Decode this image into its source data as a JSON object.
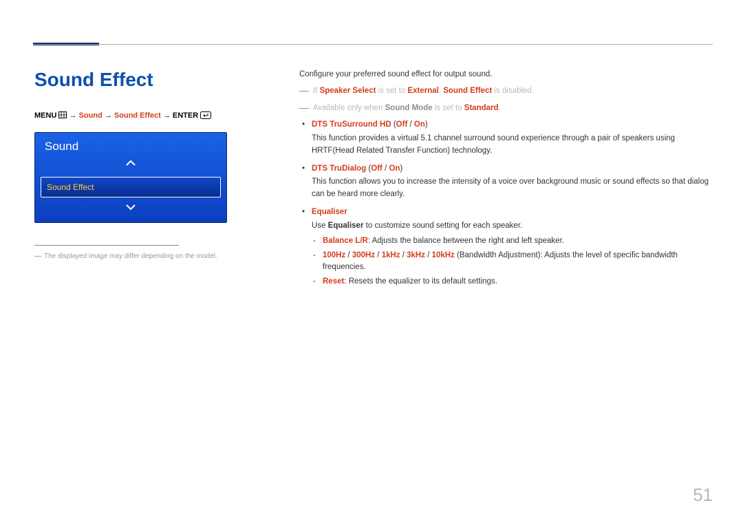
{
  "page_number": "51",
  "title": "Sound Effect",
  "path": {
    "menu_label": "MENU",
    "arrow": "→",
    "seg1": "Sound",
    "seg2": "Sound Effect",
    "enter_label": "ENTER"
  },
  "tvbox": {
    "header": "Sound",
    "item": "Sound Effect"
  },
  "left_note": "The displayed image may differ depending on the model.",
  "right": {
    "intro": "Configure your preferred sound effect for output sound.",
    "note1_pre": "If ",
    "note1_speaker_select": "Speaker Select",
    "note1_mid": " is set to ",
    "note1_external": "External",
    "note1_comma": ", ",
    "note1_sound_effect": "Sound Effect",
    "note1_post": " is disabled.",
    "note2_pre": "Available only when ",
    "note2_sound_mode": "Sound Mode",
    "note2_mid": " is set to ",
    "note2_standard": "Standard",
    "note2_post": ".",
    "f1_name": "DTS TruSurround HD",
    "f1_paren_open": " (",
    "f1_off": "Off",
    "f1_slash": " / ",
    "f1_on": "On",
    "f1_paren_close": ")",
    "f1_desc": "This function provides a virtual 5.1 channel surround sound experience through a pair of speakers using HRTF(Head Related Transfer Function) technology.",
    "f2_name": "DTS TruDialog",
    "f2_paren_open": " (",
    "f2_off": "Off",
    "f2_slash": " / ",
    "f2_on": "On",
    "f2_paren_close": ")",
    "f2_desc": "This function allows you to increase the intensity of a voice over background music or sound effects so that dialog can be heard more clearly.",
    "f3_name": "Equaliser",
    "f3_use_pre": "Use ",
    "f3_use_eq": "Equaliser",
    "f3_use_post": " to customize sound setting for each speaker.",
    "sub1_label": "Balance L/R",
    "sub1_text": ": Adjusts the balance between the right and left speaker.",
    "sub2_b1": "100Hz",
    "sub2_b2": "300Hz",
    "sub2_b3": "1kHz",
    "sub2_b4": "3kHz",
    "sub2_b5": "10kHz",
    "sub2_slash": " / ",
    "sub2_text": " (Bandwidth Adjustment): Adjusts the level of specific bandwidth frequencies.",
    "sub3_label": "Reset",
    "sub3_text": ": Resets the equalizer to its default settings."
  }
}
